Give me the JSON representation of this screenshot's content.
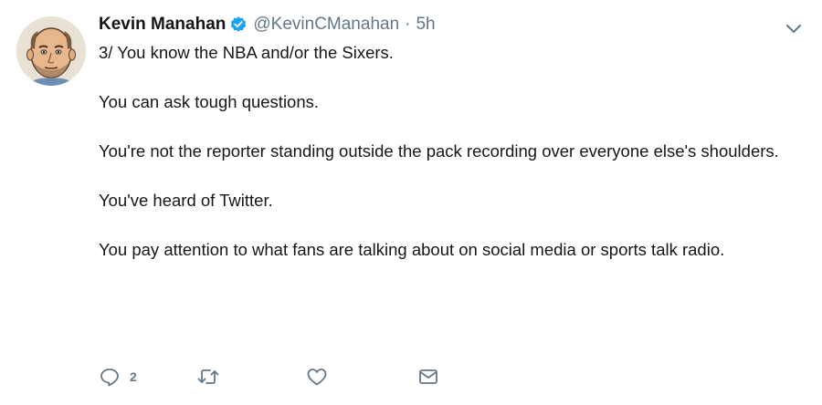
{
  "author": {
    "name": "Kevin Manahan",
    "handle": "@KevinCManahan",
    "separator": "·",
    "time": "5h",
    "verified": true
  },
  "tweet": {
    "paragraphs": [
      "3/ You know the NBA and/or the Sixers.",
      "You can ask tough questions.",
      "You're not the reporter standing outside the pack recording over everyone else's shoulders.",
      "You've heard of Twitter.",
      "You pay attention to what fans are talking about on social media or sports talk radio."
    ]
  },
  "actions": {
    "reply_count": "2",
    "icons": [
      "reply-icon",
      "retweet-icon",
      "like-icon",
      "direct-message-icon"
    ]
  },
  "colors": {
    "text": "#14171a",
    "secondary": "#657786",
    "verified": "#1da1f2"
  }
}
